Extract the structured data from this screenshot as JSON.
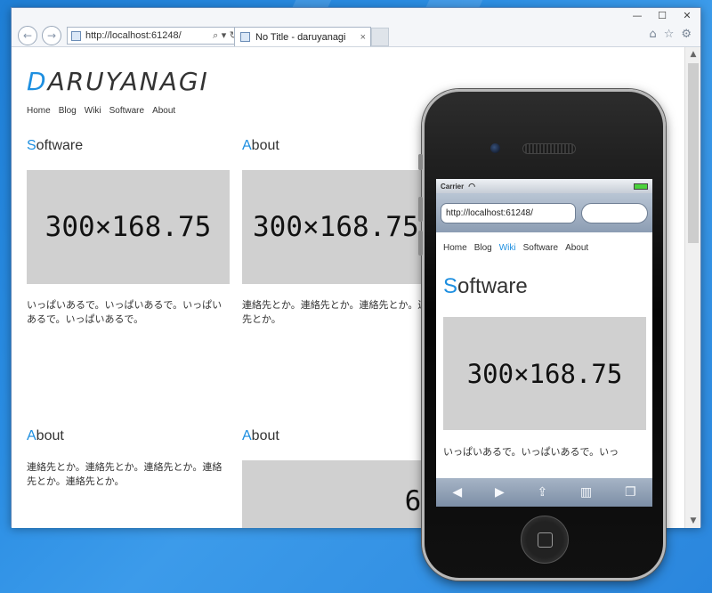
{
  "browser": {
    "address_url": "http://localhost:61248/",
    "address_tools": "⌕ ▾ ↻",
    "tab_title": "No Title - daruyanagi",
    "tab_close": "×",
    "back_glyph": "←",
    "forward_glyph": "→",
    "minimize": "—",
    "maximize": "☐",
    "close": "✕",
    "home_icon": "⌂",
    "star_icon": "☆",
    "gear_icon": "⚙"
  },
  "site": {
    "logo_first": "D",
    "logo_rest": "ARUYANAGI",
    "nav": [
      "Home",
      "Blog",
      "Wiki",
      "Software",
      "About"
    ],
    "cards": [
      {
        "title_first": "S",
        "title_rest": "oftware",
        "image_label": "300×168.75",
        "text": "いっぱいあるで。いっぱいあるで。いっぱいあるで。いっぱいあるで。"
      },
      {
        "title_first": "A",
        "title_rest": "bout",
        "image_label": "300×168.75",
        "text": "連絡先とか。連絡先とか。連絡先とか。連絡先とか。"
      },
      {
        "title_first": "A",
        "title_rest": "bout",
        "text": "連絡先とか。連絡先とか。連絡先とか。連絡先とか。連絡先とか。"
      },
      {
        "title_first": "A",
        "title_rest": "bout",
        "image_label": "64"
      }
    ]
  },
  "phone": {
    "carrier": "Carrier",
    "wifi_glyph": "◠",
    "url": "http://localhost:61248/",
    "nav": [
      "Home",
      "Blog",
      "Wiki",
      "Software",
      "About"
    ],
    "active_nav": "Wiki",
    "title_first": "S",
    "title_rest": "oftware",
    "image_label": "300×168.75",
    "text": "いっぱいあるで。いっぱいあるで。いっ",
    "toolbar": [
      "◀",
      "▶",
      "⇪",
      "▥",
      "❐"
    ]
  }
}
